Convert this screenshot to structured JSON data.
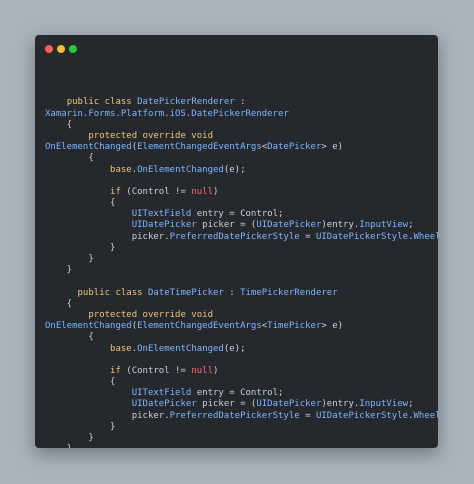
{
  "window": {
    "controls": [
      {
        "name": "close",
        "color": "#ff5f56"
      },
      {
        "name": "minimize",
        "color": "#ffbd2e"
      },
      {
        "name": "maximize",
        "color": "#27c93f"
      }
    ]
  },
  "code": {
    "lines": [
      [],
      [],
      [
        [
          "    ",
          "plain"
        ],
        [
          "public class ",
          "kw"
        ],
        [
          "DatePickerRenderer",
          "type"
        ],
        [
          " :",
          "plain"
        ]
      ],
      [
        [
          "Xamarin.Forms.Platform.iOS.DatePickerRenderer",
          "type"
        ]
      ],
      [
        [
          "    {",
          "plain"
        ]
      ],
      [
        [
          "        ",
          "plain"
        ],
        [
          "protected override void",
          "kw"
        ]
      ],
      [
        [
          "OnElementChanged",
          "type"
        ],
        [
          "(",
          "plain"
        ],
        [
          "ElementChangedEventArgs",
          "type"
        ],
        [
          "<",
          "plain"
        ],
        [
          "DatePicker",
          "type"
        ],
        [
          "> e)",
          "plain"
        ]
      ],
      [
        [
          "        {",
          "plain"
        ]
      ],
      [
        [
          "            ",
          "plain"
        ],
        [
          "base",
          "kw"
        ],
        [
          ".",
          "plain"
        ],
        [
          "OnElementChanged",
          "type"
        ],
        [
          "(e);",
          "plain"
        ]
      ],
      [],
      [
        [
          "            ",
          "plain"
        ],
        [
          "if",
          "kw"
        ],
        [
          " (Control != ",
          "plain"
        ],
        [
          "null",
          "null"
        ],
        [
          ")",
          "plain"
        ]
      ],
      [
        [
          "            {",
          "plain"
        ]
      ],
      [
        [
          "                ",
          "plain"
        ],
        [
          "UITextField",
          "type"
        ],
        [
          " entry = Control;",
          "plain"
        ]
      ],
      [
        [
          "                ",
          "plain"
        ],
        [
          "UIDatePicker",
          "type"
        ],
        [
          " picker = (",
          "plain"
        ],
        [
          "UIDatePicker",
          "type"
        ],
        [
          ")entry.",
          "plain"
        ],
        [
          "InputView",
          "type"
        ],
        [
          ";",
          "plain"
        ]
      ],
      [
        [
          "                picker.",
          "plain"
        ],
        [
          "PreferredDatePickerStyle",
          "type"
        ],
        [
          " = ",
          "plain"
        ],
        [
          "UIDatePickerStyle",
          "type"
        ],
        [
          ".",
          "plain"
        ],
        [
          "Wheels",
          "type"
        ],
        [
          ";",
          "plain"
        ]
      ],
      [
        [
          "            }",
          "plain"
        ]
      ],
      [
        [
          "        }",
          "plain"
        ]
      ],
      [
        [
          "    }",
          "plain"
        ]
      ],
      [],
      [
        [
          "      ",
          "plain"
        ],
        [
          "public class ",
          "kw"
        ],
        [
          "DateTimePicker",
          "type"
        ],
        [
          " : ",
          "plain"
        ],
        [
          "TimePickerRenderer",
          "type"
        ]
      ],
      [
        [
          "    {",
          "plain"
        ]
      ],
      [
        [
          "        ",
          "plain"
        ],
        [
          "protected override void",
          "kw"
        ]
      ],
      [
        [
          "OnElementChanged",
          "type"
        ],
        [
          "(",
          "plain"
        ],
        [
          "ElementChangedEventArgs",
          "type"
        ],
        [
          "<",
          "plain"
        ],
        [
          "TimePicker",
          "type"
        ],
        [
          "> e)",
          "plain"
        ]
      ],
      [
        [
          "        {",
          "plain"
        ]
      ],
      [
        [
          "            ",
          "plain"
        ],
        [
          "base",
          "kw"
        ],
        [
          ".",
          "plain"
        ],
        [
          "OnElementChanged",
          "type"
        ],
        [
          "(e);",
          "plain"
        ]
      ],
      [],
      [
        [
          "            ",
          "plain"
        ],
        [
          "if",
          "kw"
        ],
        [
          " (Control != ",
          "plain"
        ],
        [
          "null",
          "null"
        ],
        [
          ")",
          "plain"
        ]
      ],
      [
        [
          "            {",
          "plain"
        ]
      ],
      [
        [
          "                ",
          "plain"
        ],
        [
          "UITextField",
          "type"
        ],
        [
          " entry = Control;",
          "plain"
        ]
      ],
      [
        [
          "                ",
          "plain"
        ],
        [
          "UIDatePicker",
          "type"
        ],
        [
          " picker = (",
          "plain"
        ],
        [
          "UIDatePicker",
          "type"
        ],
        [
          ")entry.",
          "plain"
        ],
        [
          "InputView",
          "type"
        ],
        [
          ";",
          "plain"
        ]
      ],
      [
        [
          "                picker.",
          "plain"
        ],
        [
          "PreferredDatePickerStyle",
          "type"
        ],
        [
          " = ",
          "plain"
        ],
        [
          "UIDatePickerStyle",
          "type"
        ],
        [
          ".",
          "plain"
        ],
        [
          "Wheels",
          "type"
        ],
        [
          ";",
          "plain"
        ]
      ],
      [
        [
          "            }",
          "plain"
        ]
      ],
      [
        [
          "        }",
          "plain"
        ]
      ],
      [
        [
          "    }",
          "plain"
        ]
      ]
    ]
  }
}
